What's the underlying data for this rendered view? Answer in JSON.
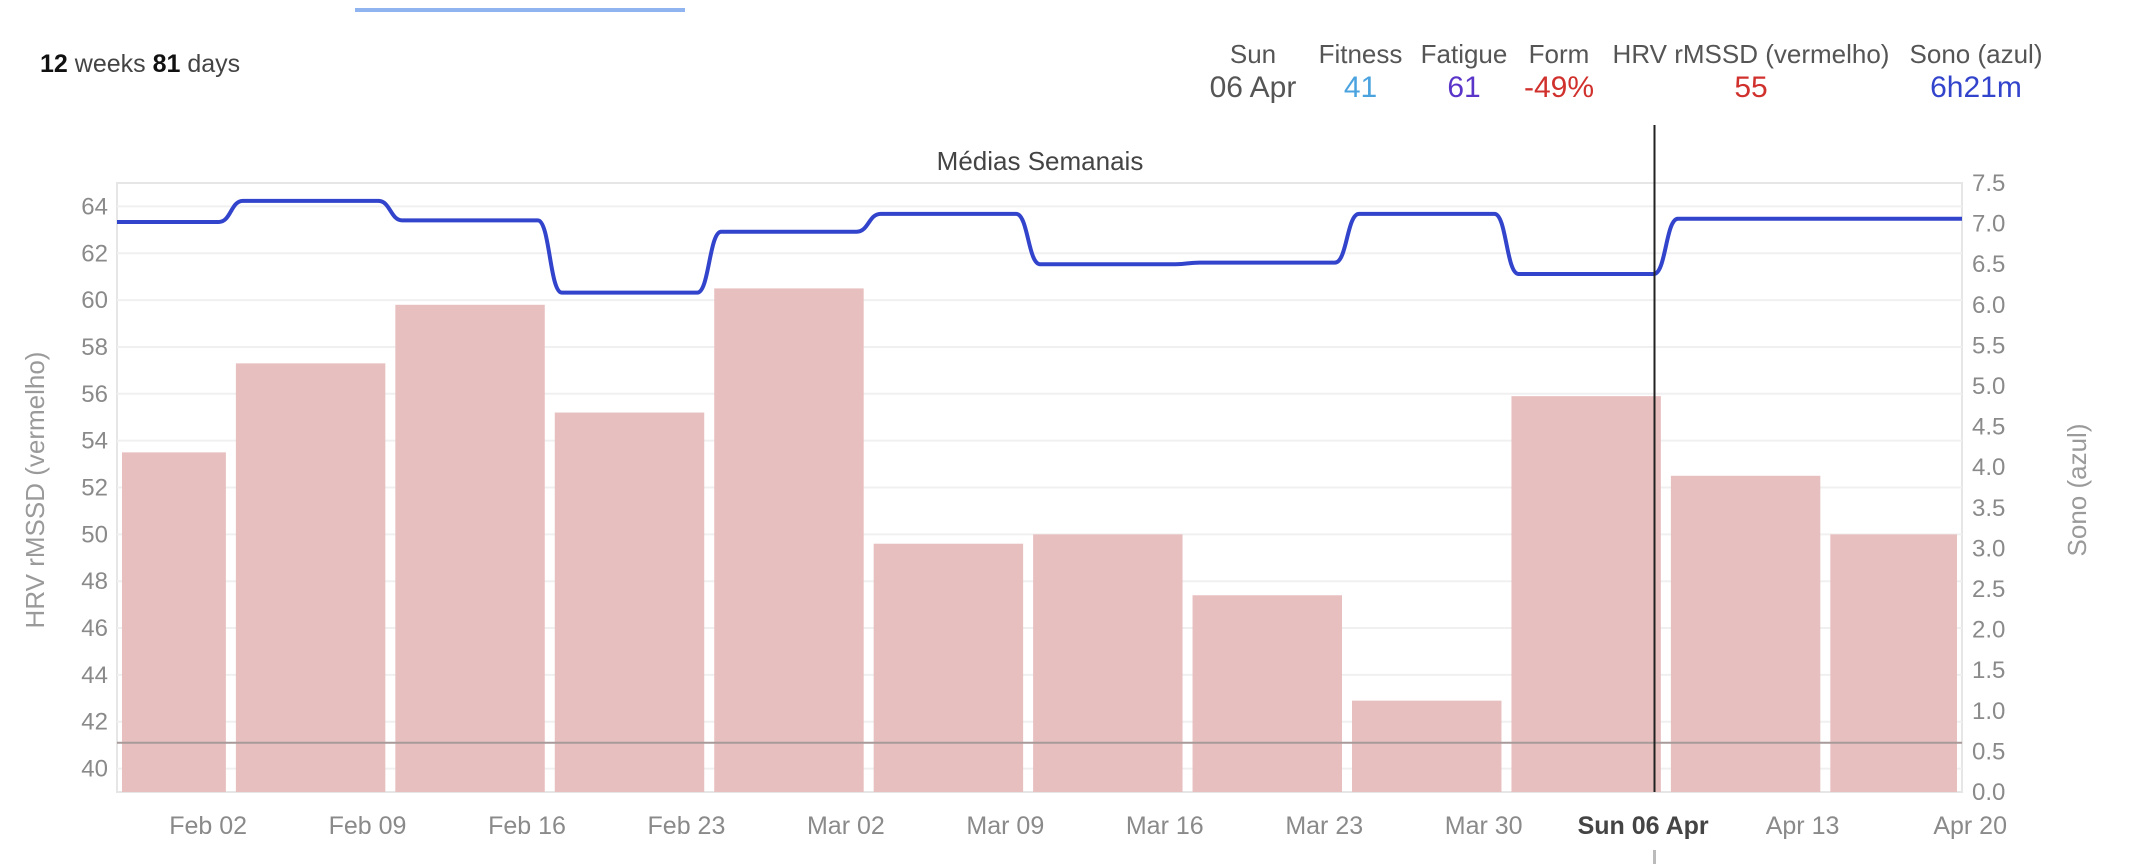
{
  "header": {
    "range_weeks": "12",
    "range_weeks_label": "weeks",
    "range_days": "81",
    "range_days_label": "days"
  },
  "readout": {
    "day": {
      "label": "Sun",
      "value": "06 Apr",
      "color": "#555555"
    },
    "fitness": {
      "label": "Fitness",
      "value": "41",
      "color": "#4aa3df"
    },
    "fatigue": {
      "label": "Fatigue",
      "value": "61",
      "color": "#5b35c9"
    },
    "form": {
      "label": "Form",
      "value": "-49%",
      "color": "#d0312d"
    },
    "hrv": {
      "label": "HRV rMSSD (vermelho)",
      "value": "55",
      "color": "#d0312d"
    },
    "sleep": {
      "label": "Sono (azul)",
      "value": "6h21m",
      "color": "#3344cc"
    }
  },
  "chart_data": {
    "type": "bar",
    "title": "Médias Semanais",
    "ylabel": "HRV rMSSD (vermelho)",
    "y2label": "Sono (azul)",
    "ylim": [
      39,
      65
    ],
    "y2lim": [
      0,
      7.5
    ],
    "yticks": [
      40,
      42,
      44,
      46,
      48,
      50,
      52,
      54,
      56,
      58,
      60,
      62,
      64
    ],
    "y2ticks": [
      "0.0",
      "0.5",
      "1.0",
      "1.5",
      "2.0",
      "2.5",
      "3.0",
      "3.5",
      "4.0",
      "4.5",
      "5.0",
      "5.5",
      "6.0",
      "6.5",
      "7.0",
      "7.5"
    ],
    "xticks": [
      "Feb 02",
      "Feb 09",
      "Feb 16",
      "Feb 23",
      "Mar 02",
      "Mar 09",
      "Mar 16",
      "Mar 23",
      "Mar 30",
      "Sun 06 Apr",
      "Apr 13",
      "Apr 20"
    ],
    "highlight_xtick": "Sun 06 Apr",
    "x_start": "2025-01-29",
    "x_end": "2025-04-20",
    "cursor_date": "2025-04-06",
    "reference_line": 41.1,
    "bar_color": "#e8bfbf",
    "line_color": "#3344cc",
    "series": [
      {
        "name": "HRV rMSSD (vermelho)",
        "values": [
          {
            "start": "2025-01-29",
            "end": "2025-02-03",
            "value": 53.5
          },
          {
            "start": "2025-02-03",
            "end": "2025-02-10",
            "value": 57.3
          },
          {
            "start": "2025-02-10",
            "end": "2025-02-17",
            "value": 59.8
          },
          {
            "start": "2025-02-17",
            "end": "2025-02-24",
            "value": 55.2
          },
          {
            "start": "2025-02-24",
            "end": "2025-03-03",
            "value": 60.5
          },
          {
            "start": "2025-03-03",
            "end": "2025-03-10",
            "value": 49.6
          },
          {
            "start": "2025-03-10",
            "end": "2025-03-17",
            "value": 50.0
          },
          {
            "start": "2025-03-17",
            "end": "2025-03-24",
            "value": 47.4
          },
          {
            "start": "2025-03-24",
            "end": "2025-03-31",
            "value": 42.9
          },
          {
            "start": "2025-03-31",
            "end": "2025-04-07",
            "value": 55.9
          },
          {
            "start": "2025-04-07",
            "end": "2025-04-14",
            "value": 52.5
          },
          {
            "start": "2025-04-14",
            "end": "2025-04-20",
            "value": 50.0
          }
        ]
      },
      {
        "name": "Sono (azul)",
        "values": [
          {
            "start": "2025-01-29",
            "end": "2025-02-03",
            "value": 7.02
          },
          {
            "start": "2025-02-03",
            "end": "2025-02-10",
            "value": 7.28
          },
          {
            "start": "2025-02-10",
            "end": "2025-02-17",
            "value": 7.04
          },
          {
            "start": "2025-02-17",
            "end": "2025-02-24",
            "value": 6.15
          },
          {
            "start": "2025-02-24",
            "end": "2025-03-03",
            "value": 6.9
          },
          {
            "start": "2025-03-03",
            "end": "2025-03-10",
            "value": 7.12
          },
          {
            "start": "2025-03-10",
            "end": "2025-03-17",
            "value": 6.5
          },
          {
            "start": "2025-03-17",
            "end": "2025-03-24",
            "value": 6.52
          },
          {
            "start": "2025-03-24",
            "end": "2025-03-31",
            "value": 7.12
          },
          {
            "start": "2025-03-31",
            "end": "2025-04-07",
            "value": 6.38
          },
          {
            "start": "2025-04-07",
            "end": "2025-04-20",
            "value": 7.06
          }
        ]
      }
    ]
  }
}
